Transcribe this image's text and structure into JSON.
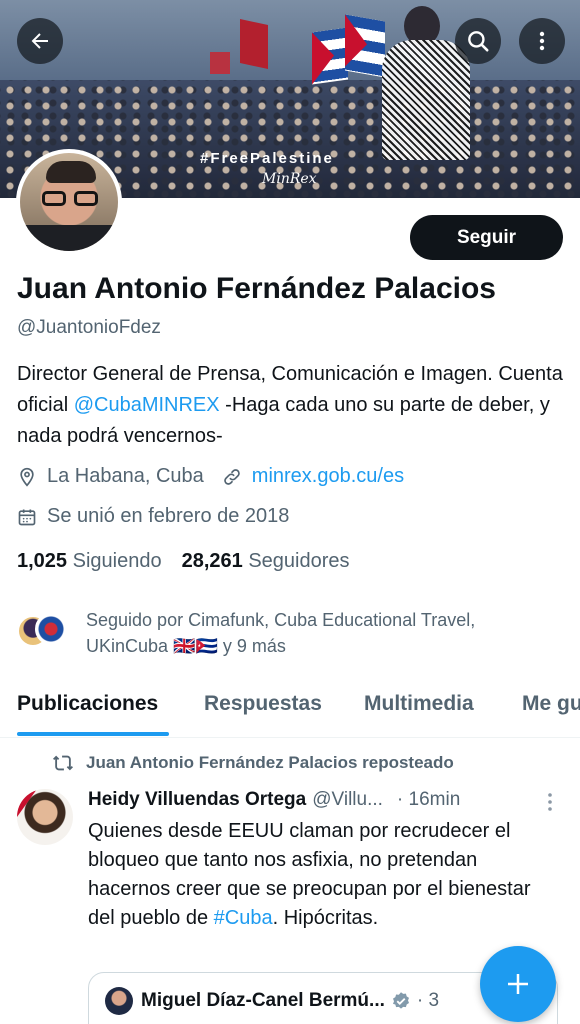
{
  "banner": {
    "hashtag": "#FreePalestine",
    "signature": "MinRex"
  },
  "profile": {
    "name": "Juan Antonio Fernández Palacios",
    "handle": "@JuantonioFdez",
    "follow_label": "Seguir",
    "bio": {
      "part1": "Director General de Prensa, Comunicación e Imagen. Cuenta oficial ",
      "mention": "@CubaMINREX",
      "part2": " -Haga cada uno su parte de deber, y nada podrá vencernos-"
    },
    "location": "La Habana, Cuba",
    "website": "minrex.gob.cu/es",
    "joined": "Se unió en febrero de 2018",
    "following_count": "1,025",
    "following_label": "Siguiendo",
    "followers_count": "28,261",
    "followers_label": "Seguidores",
    "followed_by": "Seguido por Cimafunk, Cuba Educational Travel, UKinCuba 🇬🇧🇨🇺 y 9 más"
  },
  "tabs": [
    {
      "label": "Publicaciones",
      "active": true
    },
    {
      "label": "Respuestas",
      "active": false
    },
    {
      "label": "Multimedia",
      "active": false
    },
    {
      "label": "Me gusta",
      "active": false
    }
  ],
  "post": {
    "repost_label": "Juan Antonio Fernández Palacios reposteado",
    "author_name": "Heidy Villuendas Ortega",
    "author_handle": "@Villu...",
    "time": "· 16min",
    "text_part1": "Quienes desde EEUU claman por recrudecer el bloqueo que tanto nos asfixia, no pretendan hacernos creer que se preocupan por el bienestar del pueblo de ",
    "hashtag": "#Cuba",
    "text_part2": ". Hipócritas.",
    "quote": {
      "author_name": "Miguel Díaz-Canel Bermú...",
      "rest": "· 3"
    }
  },
  "colors": {
    "accent": "#1d9bf0",
    "text": "#0f1419",
    "muted": "#536471",
    "button_dark": "#0f1419"
  },
  "icons": {
    "back": "back-arrow-icon",
    "search": "search-icon",
    "more": "more-vertical-icon",
    "location": "location-pin-icon",
    "link": "link-icon",
    "calendar": "calendar-icon",
    "repost": "repost-icon",
    "verified": "verified-badge-icon",
    "compose": "plus-icon"
  }
}
